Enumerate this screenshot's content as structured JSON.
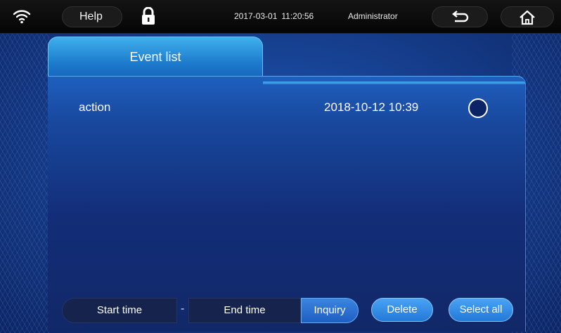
{
  "topbar": {
    "help_label": "Help",
    "date": "2017-03-01",
    "time": "11:20:56",
    "user": "Administrator",
    "icons": {
      "wifi": "wifi-icon",
      "lock": "lock-icon",
      "back": "back-arrow-icon",
      "home": "home-icon"
    }
  },
  "tab": {
    "label": "Event list"
  },
  "events": [
    {
      "name": "action",
      "datetime": "2018-10-12 10:39",
      "selected": false
    }
  ],
  "controls": {
    "start_time_label": "Start time",
    "separator": "-",
    "end_time_label": "End time",
    "inquiry_label": "Inquiry",
    "delete_label": "Delete",
    "select_all_label": "Select all"
  },
  "colors": {
    "tab_accent": "#2a8fdc",
    "panel_bg": "#153a8a",
    "button_blue": "#3590e8"
  }
}
